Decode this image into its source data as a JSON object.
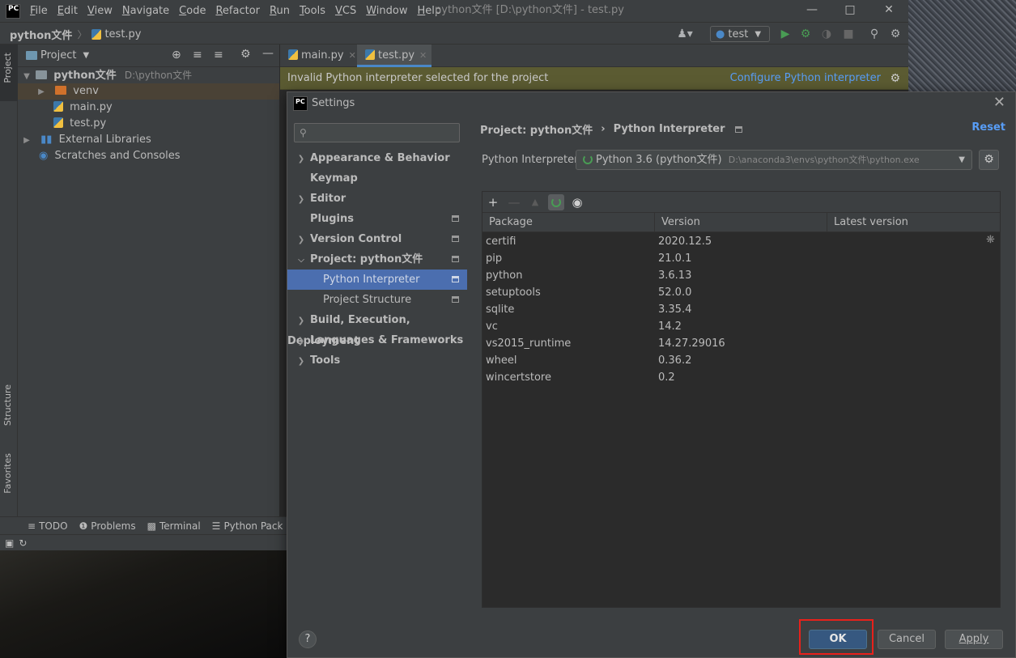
{
  "ide": {
    "logo": "PC",
    "menu": [
      "File",
      "Edit",
      "View",
      "Navigate",
      "Code",
      "Refactor",
      "Run",
      "Tools",
      "VCS",
      "Window",
      "Help"
    ],
    "window_title": "python文件 [D:\\python文件] - test.py",
    "breadcrumb": [
      "python文件",
      "test.py"
    ],
    "run_config": "test",
    "left_stripe": [
      "Project",
      "Structure",
      "Favorites"
    ],
    "project_panel": {
      "title": "Project",
      "root": "python文件",
      "root_path": "D:\\python文件",
      "items": [
        "venv",
        "main.py",
        "test.py"
      ],
      "external": "External Libraries",
      "scratches": "Scratches and Consoles"
    },
    "editor_tabs": [
      "main.py",
      "test.py"
    ],
    "banner": {
      "text": "Invalid Python interpreter selected for the project",
      "link": "Configure Python interpreter"
    },
    "bottom_tabs": [
      "TODO",
      "Problems",
      "Terminal",
      "Python Pack"
    ]
  },
  "settings": {
    "title": "Settings",
    "nav": [
      {
        "label": "Appearance & Behavior"
      },
      {
        "label": "Keymap"
      },
      {
        "label": "Editor"
      },
      {
        "label": "Plugins"
      },
      {
        "label": "Version Control"
      },
      {
        "label": "Project: python文件"
      },
      {
        "label": "Python Interpreter"
      },
      {
        "label": "Project Structure"
      },
      {
        "label": "Build, Execution, Deployment"
      },
      {
        "label": "Languages & Frameworks"
      },
      {
        "label": "Tools"
      }
    ],
    "breadcrumb": {
      "project": "Project: python文件",
      "sep": "›",
      "page": "Python Interpreter"
    },
    "reset": "Reset",
    "interpreter_label": "Python Interpreter:",
    "interpreter_value": "Python 3.6 (python文件)",
    "interpreter_path": "D:\\anaconda3\\envs\\python文件\\python.exe",
    "columns": [
      "Package",
      "Version",
      "Latest version"
    ],
    "packages": [
      {
        "name": "certifi",
        "version": "2020.12.5"
      },
      {
        "name": "pip",
        "version": "21.0.1"
      },
      {
        "name": "python",
        "version": "3.6.13"
      },
      {
        "name": "setuptools",
        "version": "52.0.0"
      },
      {
        "name": "sqlite",
        "version": "3.35.4"
      },
      {
        "name": "vc",
        "version": "14.2"
      },
      {
        "name": "vs2015_runtime",
        "version": "14.27.29016"
      },
      {
        "name": "wheel",
        "version": "0.36.2"
      },
      {
        "name": "wincertstore",
        "version": "0.2"
      }
    ],
    "buttons": {
      "help": "?",
      "ok": "OK",
      "cancel": "Cancel",
      "apply": "Apply"
    }
  },
  "colors": {
    "accent": "#4b6eaf",
    "highlight": "#e8211b",
    "link": "#589df6",
    "banner": "#5b5b32"
  }
}
